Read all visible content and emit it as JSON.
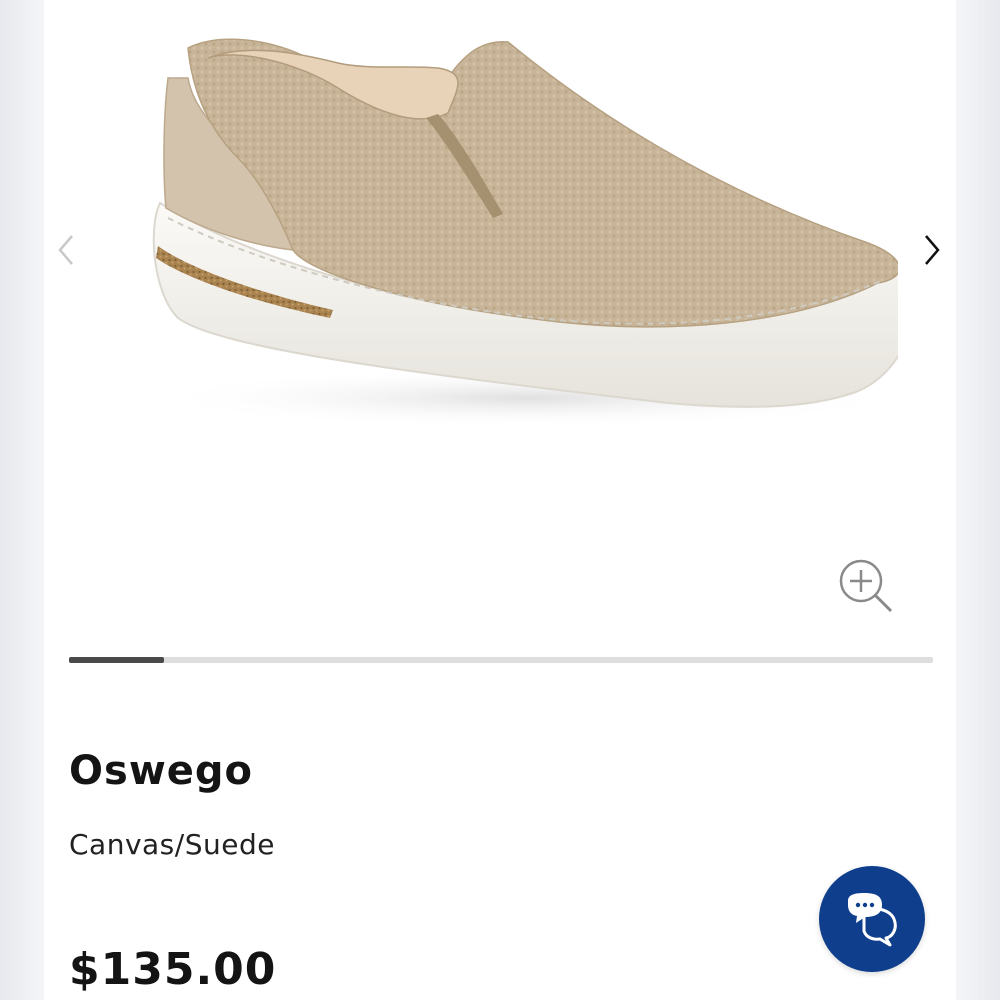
{
  "gallery": {
    "image_alt": "Oswego slip-on shoe",
    "prev_icon": "chevron-left-icon",
    "next_icon": "chevron-right-icon",
    "zoom_icon": "zoom-in-icon",
    "progress_fraction": 0.11
  },
  "product": {
    "name": "Oswego",
    "material": "Canvas/Suede",
    "price": "$135.00"
  },
  "chat": {
    "icon": "chat-bubbles-icon"
  },
  "colors": {
    "chat_bg": "#0f3e8c",
    "progress_fill": "#4a4a4a",
    "progress_track": "#dedede",
    "shoe_upper": "#c9b59a",
    "sole": "#f3f1ec",
    "cork": "#a07a4a"
  }
}
